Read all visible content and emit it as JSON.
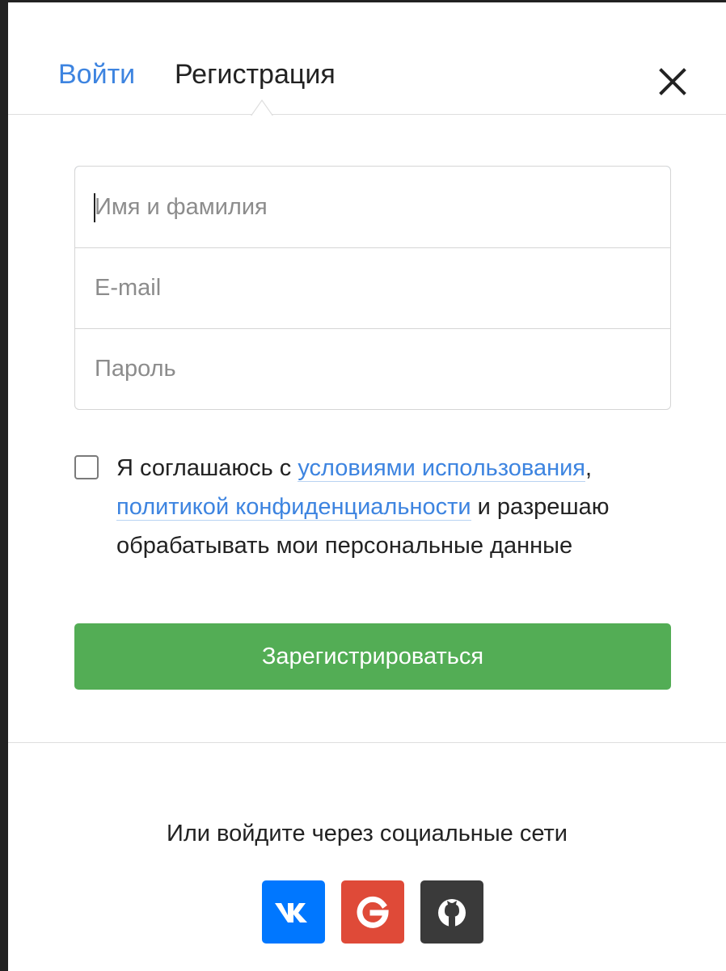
{
  "tabs": {
    "login_label": "Войти",
    "register_label": "Регистрация",
    "active": "register"
  },
  "close": {
    "icon": "close-icon"
  },
  "form": {
    "name_placeholder": "Имя и фамилия",
    "email_placeholder": "E-mail",
    "password_placeholder": "Пароль"
  },
  "agreement": {
    "checked": false,
    "prefix": "Я соглашаюсь с ",
    "terms_link": "условиями использования",
    "comma": ",",
    "privacy_link": "политикой конфиденциальности",
    "suffix": " и разрешаю обрабатывать мои персональные данные"
  },
  "submit_label": "Зарегистрироваться",
  "social": {
    "caption": "Или войдите через социальные сети",
    "buttons": [
      {
        "name": "vk",
        "icon": "vk-icon",
        "color": "#0077ff"
      },
      {
        "name": "google",
        "icon": "google-icon",
        "color": "#df4a38"
      },
      {
        "name": "github",
        "icon": "github-icon",
        "color": "#3a3a3a"
      }
    ]
  },
  "colors": {
    "link": "#3d84e0",
    "primary_button": "#53ad55",
    "focus_border": "#9ecbf3"
  }
}
